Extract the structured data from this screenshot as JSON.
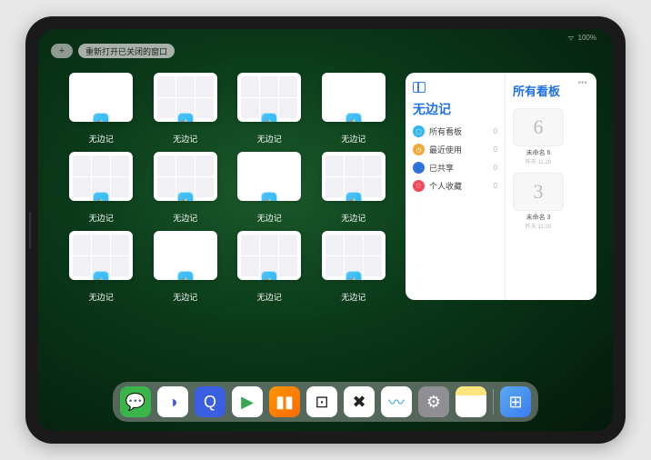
{
  "status": {
    "wifi": "ᯤ",
    "battery": "100%"
  },
  "topbar": {
    "plus": "+",
    "reopen_label": "重新打开已关闭的窗口"
  },
  "grid": {
    "items": [
      {
        "label": "无边记",
        "type": "blank"
      },
      {
        "label": "无边记",
        "type": "detail"
      },
      {
        "label": "无边记",
        "type": "detail"
      },
      {
        "label": "无边记",
        "type": "blank"
      },
      {
        "label": "无边记",
        "type": "detail"
      },
      {
        "label": "无边记",
        "type": "detail"
      },
      {
        "label": "无边记",
        "type": "blank"
      },
      {
        "label": "无边记",
        "type": "detail"
      },
      {
        "label": "无边记",
        "type": "detail"
      },
      {
        "label": "无边记",
        "type": "blank"
      },
      {
        "label": "无边记",
        "type": "detail"
      },
      {
        "label": "无边记",
        "type": "detail"
      }
    ]
  },
  "panel": {
    "left_title": "无边记",
    "right_title": "所有看板",
    "rows": [
      {
        "icon_color": "#2fb7ef",
        "glyph": "▢",
        "label": "所有看板",
        "count": "0"
      },
      {
        "icon_color": "#f2a93c",
        "glyph": "◷",
        "label": "最近使用",
        "count": "0"
      },
      {
        "icon_color": "#3a6fe0",
        "glyph": "👤",
        "label": "已共享",
        "count": "0"
      },
      {
        "icon_color": "#ef4a5b",
        "glyph": "♡",
        "label": "个人收藏",
        "count": "0"
      }
    ],
    "boards": [
      {
        "glyph": "6",
        "caption": "未命名 6",
        "sub": "昨天 11:28"
      },
      {
        "glyph": "3",
        "caption": "未命名 3",
        "sub": "昨天 11:28"
      }
    ]
  },
  "dock": {
    "icons": [
      {
        "name": "wechat-icon",
        "bg": "#39b54a",
        "glyph": "💬"
      },
      {
        "name": "quark-icon-1",
        "bg": "#ffffff",
        "glyph": "◑",
        "fg": "#3a5ee0"
      },
      {
        "name": "quark-icon-2",
        "bg": "#3a5ee0",
        "glyph": "Q"
      },
      {
        "name": "play-icon",
        "bg": "#ffffff",
        "glyph": "▶",
        "fg": "#34a853"
      },
      {
        "name": "books-icon",
        "bg": "linear-gradient(135deg,#ff9500,#ff6a00)",
        "glyph": "▮▮",
        "fg": "#fff"
      },
      {
        "name": "dice-icon",
        "bg": "#ffffff",
        "glyph": "⊡",
        "fg": "#222"
      },
      {
        "name": "controller-icon",
        "bg": "#ffffff",
        "glyph": "✖",
        "fg": "#222"
      },
      {
        "name": "freeform-icon",
        "bg": "#ffffff",
        "glyph": "〰",
        "fg": "#3aa0e0"
      },
      {
        "name": "settings-icon",
        "bg": "#8e8e93",
        "glyph": "⚙"
      },
      {
        "name": "notes-icon",
        "bg": "linear-gradient(#ffe680 30%,#fff 30%)",
        "glyph": "",
        "fg": "#333"
      },
      {
        "name": "app-library-icon",
        "bg": "linear-gradient(135deg,#5aa9f0,#3a7cf0)",
        "glyph": "⊞"
      }
    ]
  }
}
